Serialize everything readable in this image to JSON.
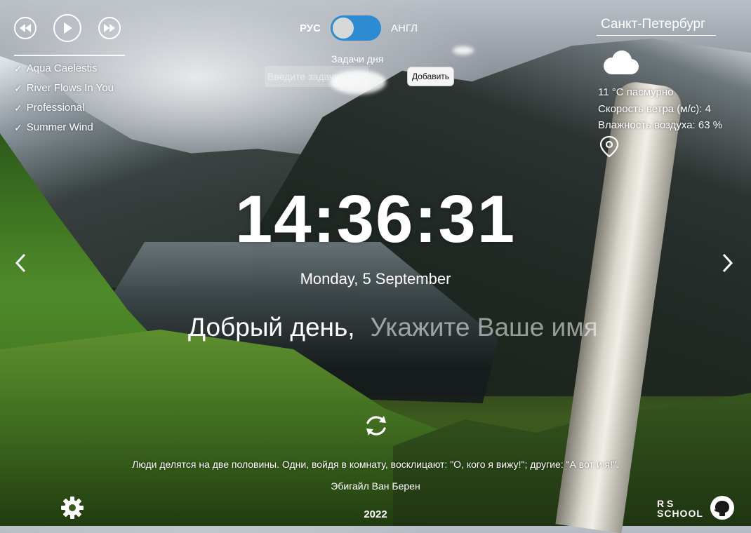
{
  "player": {
    "tracks": [
      {
        "title": "Aqua Caelestis",
        "check": "✓"
      },
      {
        "title": "River Flows In You",
        "check": "✓"
      },
      {
        "title": "Professional",
        "check": "✓"
      },
      {
        "title": "Summer Wind",
        "check": "✓"
      }
    ],
    "icons": {
      "prev": "skip-back-icon",
      "play": "play-icon",
      "next": "skip-forward-icon"
    }
  },
  "language": {
    "ru_label": "РУС",
    "en_label": "АНГЛ",
    "selected": "ru"
  },
  "todo": {
    "title": "Задачи дня",
    "placeholder": "Введите задачу",
    "add_label": "Добавить"
  },
  "weather": {
    "city": "Санкт-Петербург",
    "temp_desc": "11 °С   пасмурно",
    "wind": "Скорость ветра (м/с): 4",
    "humidity": "Влажность воздуха: 63 %",
    "icon": "cloud-icon"
  },
  "clock": {
    "time": "14:36:31",
    "date": "Monday, 5 September"
  },
  "greeting": {
    "text": "Добрый день,",
    "name_placeholder": "Укажите Ваше имя"
  },
  "quote": {
    "text": "Люди делятся на две половины. Одни, войдя в комнату, восклицают: \"О, кого я вижу!\"; другие: \"А вот и я!\".",
    "author": "Эбигайл Ван Берен"
  },
  "footer": {
    "year": "2022",
    "rs_top": "R  S",
    "rs_bottom": "SCHOOL"
  },
  "colors": {
    "toggle_accent": "#2c8bd1",
    "text": "#ffffff"
  }
}
